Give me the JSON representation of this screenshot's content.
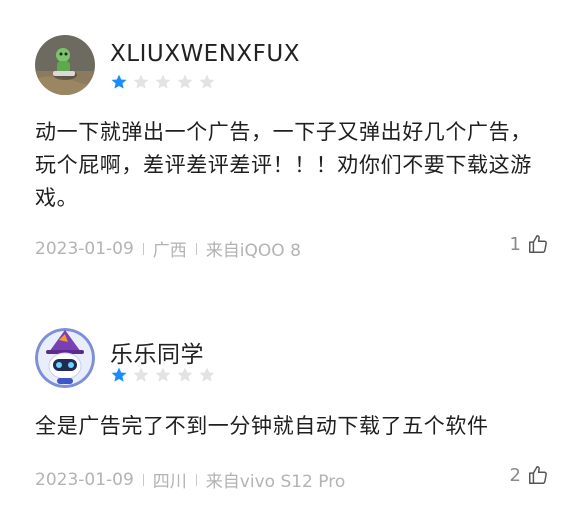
{
  "reviews": [
    {
      "username": "XLIUXWENXFUX",
      "rating": 1,
      "content": "动一下就弹出一个广告，一下子又弹出好几个广告，玩个屁啊，差评差评差评！！！劝你们不要下载这游戏。",
      "date": "2023-01-09",
      "location": "广西",
      "device": "来自iQOO 8",
      "likes": "1"
    },
    {
      "username": "乐乐同学",
      "rating": 1,
      "content": "全是广告完了不到一分钟就自动下载了五个软件",
      "date": "2023-01-09",
      "location": "四川",
      "device": "来自vivo S12 Pro",
      "likes": "2"
    }
  ],
  "colors": {
    "star_filled": "#1a8cff",
    "star_empty": "#e3e3e3",
    "meta_text": "#b3b3b3"
  },
  "icons": [
    "star-icon",
    "thumbs-up-icon"
  ]
}
